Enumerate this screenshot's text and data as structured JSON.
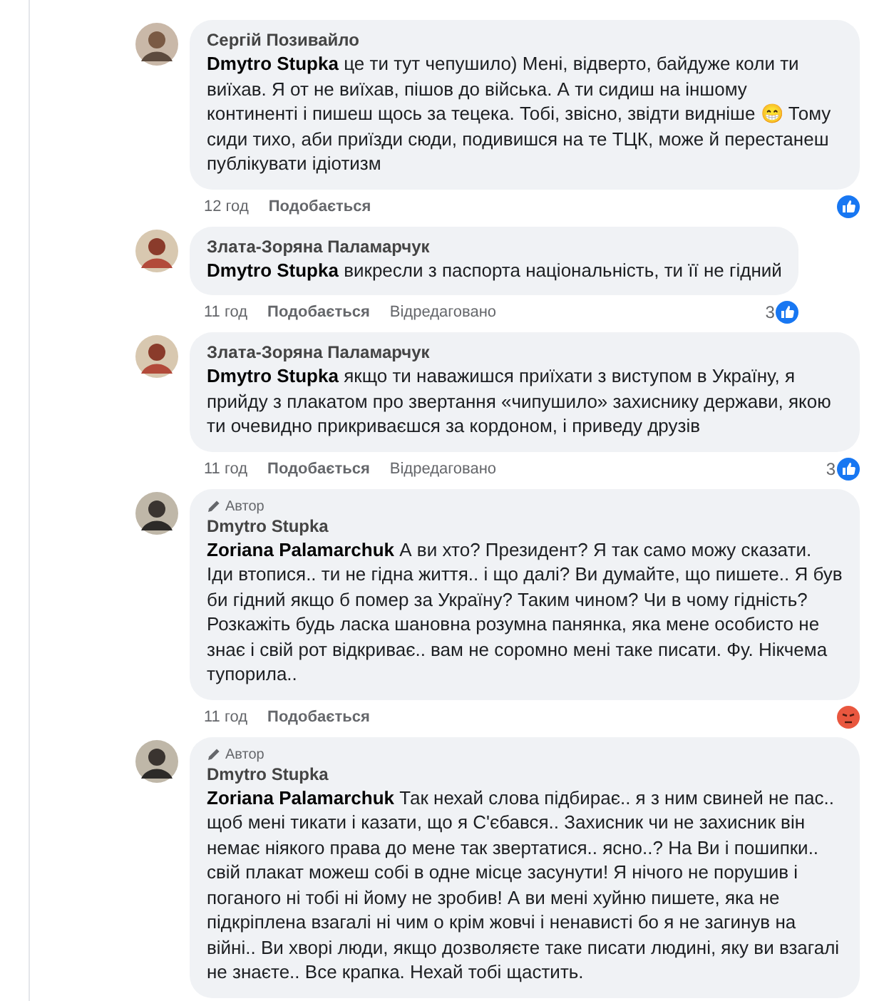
{
  "comments": [
    {
      "author": "Сергій Позивайло",
      "mention": "Dmytro Stupka",
      "text": "це ти тут чепушило) Мені, відверто, байдуже коли ти виїхав. Я от не виїхав, пішов до війська. А ти сидиш на іншому континенті і пишеш щось за тецека. Тобі, звісно, звідти видніше 😁 Тому сиди тихо, аби приїзди сюди, подивишся на те ТЦК, може й перестанеш публікувати ідіотизм",
      "time": "12 год",
      "like": "Подобається",
      "reaction": {
        "kind": "like"
      }
    },
    {
      "author": "Злата-Зоряна Паламарчук",
      "mention": "Dmytro Stupka",
      "text": "викресли з паспорта національність, ти її не гідний",
      "time": "11 год",
      "like": "Подобається",
      "edited": "Відредаговано",
      "reaction": {
        "kind": "like",
        "count": "3"
      }
    },
    {
      "author": "Злата-Зоряна Паламарчук",
      "mention": "Dmytro Stupka",
      "text": "якщо ти наважишся приїхати з виступом в Україну, я прийду з плакатом про звертання «чипушило» захиснику держави, якою ти очевидно прикриваєшся за кордоном, і приведу друзів",
      "time": "11 год",
      "like": "Подобається",
      "edited": "Відредаговано",
      "reaction": {
        "kind": "like",
        "count": "3"
      }
    },
    {
      "badge": "Автор",
      "author": "Dmytro Stupka",
      "mention": "Zoriana Palamarchuk",
      "text": "А ви хто? Президент? Я так само можу сказати. Іди втопися.. ти не гідна життя.. і що далі? Ви думайте, що пишете.. Я був би гідний якщо б помер за Україну? Таким чином? Чи в чому гідність? Розкажіть будь ласка шановна розумна панянка, яка мене особисто не знає і свій рот відкриває.. вам не соромно мені таке писати. Фу. Нікчема тупорила..",
      "time": "11 год",
      "like": "Подобається",
      "reaction": {
        "kind": "angry"
      }
    },
    {
      "badge": "Автор",
      "author": "Dmytro Stupka",
      "mention": "Zoriana Palamarchuk",
      "text": "Так нехай слова підбирає.. я з ним свиней не пас.. щоб мені тикати і казати, що я С'єбався.. Захисник чи не захисник він немає ніякого права до мене так звертатися.. ясно..? На Ви і пошипки.. свій плакат можеш собі в одне місце засунути! Я нічого не порушив і поганого ні тобі ні йому не зробив! А ви мені хуйню пишете, яка не підкріплена взагалі ні чим о крім жовчі і ненависті бо я не загинув на війні.. Ви хворі люди, якщо дозволяєте таке писати людині, яку ви взагалі не знаєте.. Все крапка. Нехай тобі щастить."
    }
  ]
}
